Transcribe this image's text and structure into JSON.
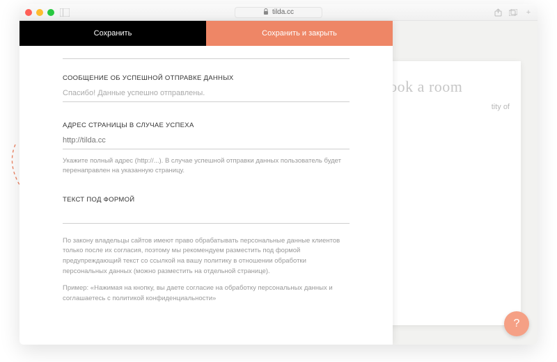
{
  "browser": {
    "url": "tilda.cc"
  },
  "header": {
    "save": "Сохранить",
    "save_close": "Сохранить и закрыть"
  },
  "preview": {
    "title": "Book a room",
    "subtitle_fragment": "tity of"
  },
  "fields": {
    "success_msg": {
      "label": "СООБЩЕНИЕ ОБ УСПЕШНОЙ ОТПРАВКЕ ДАННЫХ",
      "value": "Спасибо! Данные успешно отправлены."
    },
    "success_url": {
      "label": "АДРЕС СТРАНИЦЫ В СЛУЧАЕ УСПЕХА",
      "placeholder": "http://tilda.cc",
      "hint": "Укажите полный адрес (http://...). В случае успешной отправки данных пользователь будет перенаправлен на указанную страницу."
    },
    "under_form": {
      "label": "ТЕКСТ ПОД ФОРМОЙ",
      "desc1": "По закону владельцы сайтов имеют право обрабатывать персональные данные клиентов только после их согласия, поэтому мы рекомендуем разместить под формой предупреждающий текст со ссылкой на вашу политику в отношении обработки персональных данных (можно разместить на отдельной странице).",
      "desc2": "Пример: «Нажимая на кнопку, вы даете согласие на обработку персональных данных и соглашаетесь c политикой конфиденциальности»"
    }
  },
  "help": "?"
}
